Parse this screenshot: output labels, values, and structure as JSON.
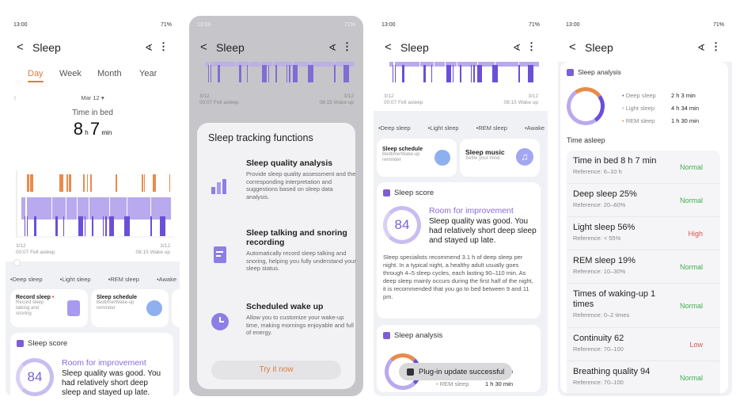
{
  "status": {
    "time": "13:00",
    "battery": "71%"
  },
  "header": {
    "back": "<",
    "title": "Sleep",
    "share_icon": "share-icon",
    "more_icon": "more-icon"
  },
  "tabs": [
    {
      "label": "Day",
      "active": true
    },
    {
      "label": "Week"
    },
    {
      "label": "Month"
    },
    {
      "label": "Year"
    }
  ],
  "date_picker": {
    "label": "Mar 12 ▾"
  },
  "summary": {
    "label": "Time in bed",
    "hours": "8",
    "h_unit": "h",
    "minutes": "7",
    "min_unit": "min"
  },
  "chart": {
    "start_date": "3/12",
    "start_label": "00:07 Fell asleep",
    "end_date": "3/12",
    "end_label": "08:15 Wake up"
  },
  "legend": [
    "•Deep sleep",
    "•Light sleep",
    "•REM sleep",
    "•Awake"
  ],
  "feature_cards": {
    "record": {
      "title": "Record sleep",
      "desc": "Record sleep talking and snoring"
    },
    "schedule": {
      "title": "Sleep schedule",
      "desc": "Bedtime/Wake-up reminder"
    },
    "music": {
      "title": "Sleep music",
      "desc": "Settle your mind."
    }
  },
  "score": {
    "title": "Sleep score",
    "value": "84",
    "verdict": "Room for improvement",
    "summary": "Sleep quality was good. You had relatively short deep sleep and stayed up late.",
    "advice": "Sleep specialists recommend 3.1 h of deep sleep per night. In a typical night, a healthy adult usually goes through 4–5 sleep cycles, each lasting 90–110 min. As deep sleep mainly occurs during the first half of the night, it is recommended that you go to bed between 9 and 11 pm."
  },
  "dialog": {
    "title": "Sleep tracking functions",
    "items": [
      {
        "title": "Sleep quality analysis",
        "desc": "Provide sleep quality assessment and the corresponding interpretation and suggestions based on sleep data analysis."
      },
      {
        "title": "Sleep talking and snoring recording",
        "desc": "Automatically record sleep talking and snoring, helping you fully understand your sleep status."
      },
      {
        "title": "Scheduled wake up",
        "desc": "Allow you to customize your wake-up time, making mornings enjoyable and full of energy."
      }
    ],
    "button": "Try it now"
  },
  "toast": "Plug-in update successful",
  "analysis": {
    "title": "Sleep analysis",
    "items": [
      {
        "label": "Deep sleep",
        "value": "2 h 3 min",
        "color": "#6b4fd8"
      },
      {
        "label": "Light sleep",
        "value": "4 h 34 min",
        "color": "#b9a9ee"
      },
      {
        "label": "REM sleep",
        "value": "1 h 30 min",
        "color": "#e98b4c"
      }
    ],
    "time_asleep": "Time asleep",
    "rows": [
      {
        "title": "Time in bed 8 h 7 min",
        "ref": "Reference: 6–10 h",
        "status": "Normal"
      },
      {
        "title": "Deep sleep 25%",
        "ref": "Reference: 20–60%",
        "status": "Normal"
      },
      {
        "title": "Light sleep 56%",
        "ref": "Reference: < 55%",
        "status": "High"
      },
      {
        "title": "REM sleep 19%",
        "ref": "Reference: 10–30%",
        "status": "Normal"
      },
      {
        "title": "Times of waking-up 1 times",
        "ref": "Reference: 0–2 times",
        "status": "Normal"
      },
      {
        "title": "Continuity 62",
        "ref": "Reference: 70–100",
        "status": "Low"
      },
      {
        "title": "Breathing quality 94",
        "ref": "Reference: 70–100",
        "status": "Normal"
      }
    ]
  },
  "colors": {
    "accent": "#e07a3c",
    "purple": "#7b5fd6",
    "normal": "#3fae50",
    "bad": "#d9534f"
  }
}
